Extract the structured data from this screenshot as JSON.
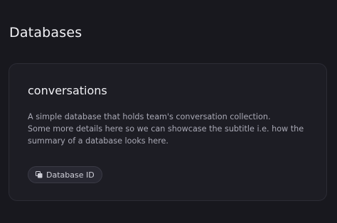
{
  "header": {
    "title": "Databases"
  },
  "database_card": {
    "name": "conversations",
    "description_lines": [
      "A simple database that holds team's conversation collection.",
      "Some more details here so we can showcase the subtitle i.e. how the",
      "summary of a database looks here."
    ],
    "id_button": {
      "icon": "copy-icon",
      "label": "Database ID"
    }
  },
  "colors": {
    "background": "#18181e",
    "card": "#1d1d24",
    "text_primary": "#f1f1f5",
    "text_secondary": "#a9a9b5"
  }
}
